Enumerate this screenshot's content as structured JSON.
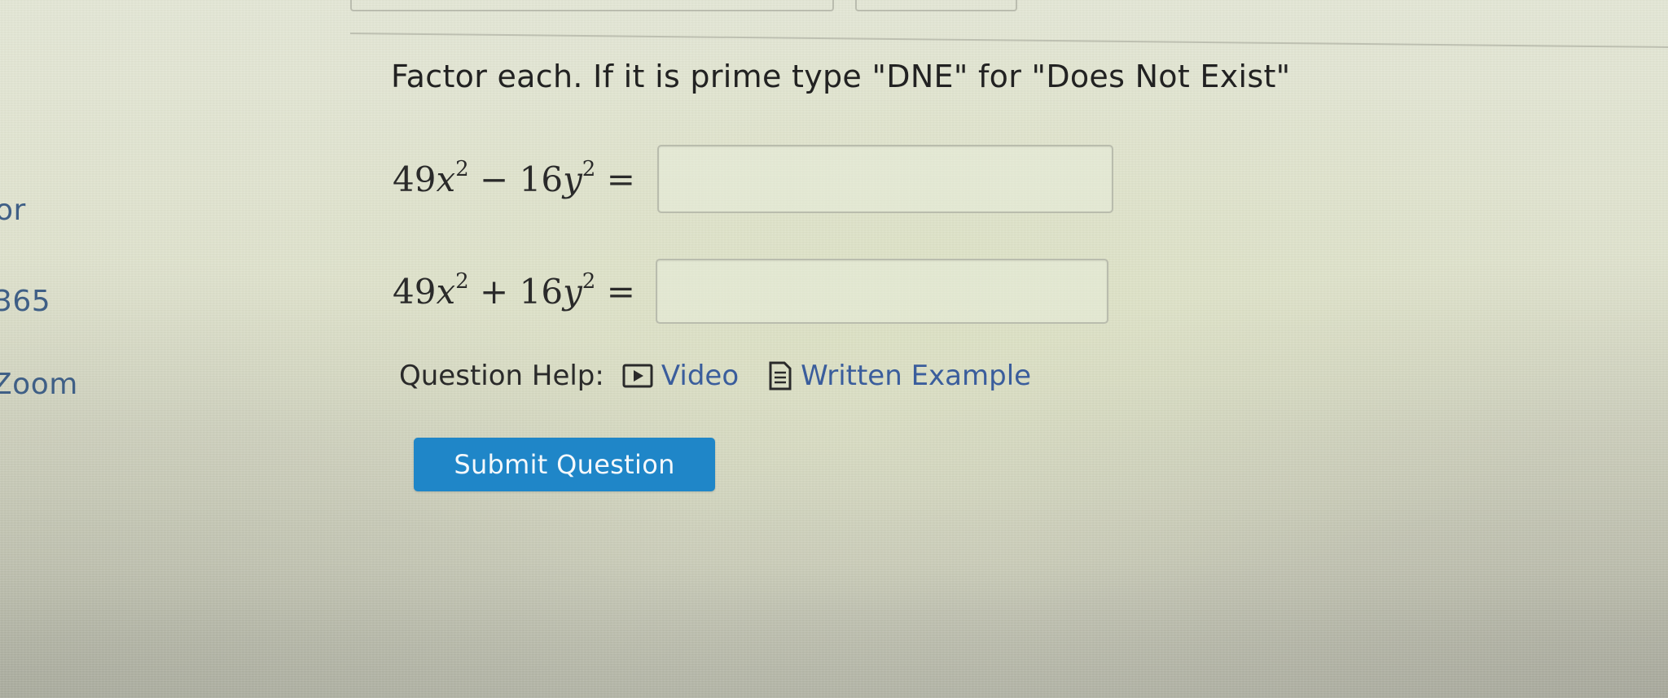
{
  "sidebar": {
    "items": [
      {
        "label": "or"
      },
      {
        "label": "365"
      },
      {
        "label": "Zoom"
      }
    ]
  },
  "question": {
    "prompt": "Factor each. If it is prime type \"DNE\" for \"Does Not Exist\"",
    "equations": [
      {
        "coef_a": "49",
        "var_a": "x",
        "exp_a": "2",
        "op": "−",
        "coef_b": "16",
        "var_b": "y",
        "exp_b": "2",
        "eq": "=",
        "answer_value": ""
      },
      {
        "coef_a": "49",
        "var_a": "x",
        "exp_a": "2",
        "op": "+",
        "coef_b": "16",
        "var_b": "y",
        "exp_b": "2",
        "eq": "=",
        "answer_value": ""
      }
    ]
  },
  "help": {
    "label": "Question Help:",
    "links": [
      {
        "label": "Video",
        "icon": "video-play-icon"
      },
      {
        "label": "Written Example",
        "icon": "document-icon"
      }
    ]
  },
  "actions": {
    "submit_label": "Submit Question"
  },
  "colors": {
    "link": "#3a5d9c",
    "sidebar_link": "#3f5f86",
    "submit_bg": "#1f86c8"
  }
}
